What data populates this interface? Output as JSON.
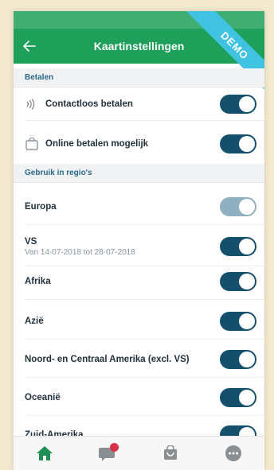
{
  "header": {
    "title": "Kaartinstellingen",
    "ribbon": "DEMO"
  },
  "sections": {
    "betalen": {
      "title": "Betalen",
      "items": [
        {
          "label": "Contactloos betalen",
          "icon": "contactless-icon",
          "enabled": true
        },
        {
          "label": "Online betalen mogelijk",
          "icon": "shopping-bag-icon",
          "enabled": true
        }
      ]
    },
    "regios": {
      "title": "Gebruik in regio's",
      "items": [
        {
          "label": "Europa",
          "enabled": true,
          "disabled": true
        },
        {
          "label": "VS",
          "sublabel": "Van 14-07-2018 tot 28-07-2018",
          "enabled": true
        },
        {
          "label": "Afrika",
          "enabled": true
        },
        {
          "label": "Azië",
          "enabled": true
        },
        {
          "label": "Noord- en Centraal Amerika (excl. VS)",
          "enabled": true
        },
        {
          "label": "Oceanië",
          "enabled": true
        },
        {
          "label": "Zuid-Amerika",
          "enabled": true
        }
      ]
    }
  },
  "tabbar": {
    "tabs": [
      {
        "icon": "home-icon",
        "active": true
      },
      {
        "icon": "messages-icon",
        "badge": true
      },
      {
        "icon": "shop-icon"
      },
      {
        "icon": "more-icon"
      }
    ]
  },
  "colors": {
    "brand_green": "#1ea05a",
    "toggle_on": "#14506b",
    "toggle_disabled": "#8fb0c0",
    "ribbon": "#3fc3e0",
    "badge": "#d7324a"
  }
}
